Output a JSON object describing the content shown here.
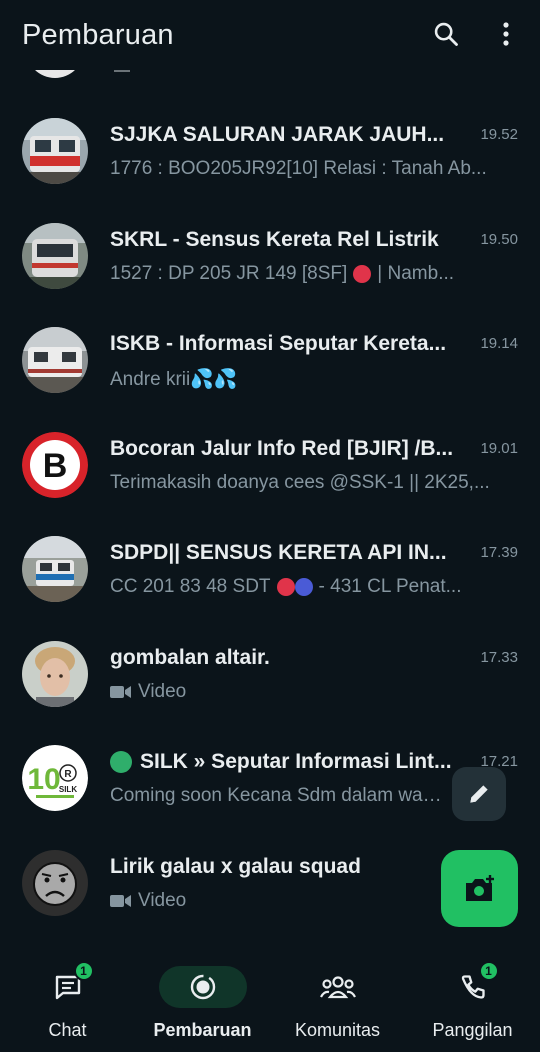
{
  "header": {
    "title": "Pembaruan"
  },
  "colors": {
    "background": "#0b141a",
    "accent": "#21c063",
    "secondary_text": "#8696a0"
  },
  "chats": [
    {
      "title": "SJJKA SALURAN JARAK JAUH...",
      "time": "19.52",
      "preview": "1776 : BOO205JR92[10] Relasi : Tanah Ab...",
      "avatar_icon": "train-photo-icon"
    },
    {
      "title": "SKRL - Sensus Kereta Rel Listrik",
      "time": "19.50",
      "preview": "1527 : DP 205 JR 149 [8SF]",
      "preview_suffix": "| Namb...",
      "avatar_icon": "train-photo-icon"
    },
    {
      "title": "ISKB - Informasi Seputar Kereta...",
      "time": "19.14",
      "preview": "Andre krii💦💦",
      "avatar_icon": "train-photo-icon"
    },
    {
      "title": "Bocoran Jalur Info Red [BJIR] /B...",
      "time": "19.01",
      "preview": "Terimakasih doanya cees @SSK-1 || 2K25,...",
      "avatar_icon": "letter-b-logo-icon",
      "avatar_letter": "B"
    },
    {
      "title": "SDPD|| SENSUS KERETA API IN...",
      "time": "17.39",
      "preview": "CC 201 83 48 SDT",
      "preview_suffix": "- 431 CL Penat...",
      "avatar_icon": "train-photo-icon"
    },
    {
      "title": "gombalan altair.",
      "time": "17.33",
      "preview": "Video",
      "avatar_icon": "person-photo-icon"
    },
    {
      "title": "SILK » Seputar Informasi Lint...",
      "time": "17.21",
      "preview": "Coming soon Kecana Sdm dalam wak...",
      "avatar_icon": "silk-logo-icon",
      "avatar_number": "10",
      "avatar_letter": "R",
      "avatar_text": "SILK"
    },
    {
      "title": "Lirik galau x galau squad",
      "time": "",
      "preview": "Video",
      "avatar_icon": "sad-face-icon"
    }
  ],
  "nav": [
    {
      "label": "Chat",
      "badge": "1",
      "icon": "chat-icon"
    },
    {
      "label": "Pembaruan",
      "icon": "updates-icon",
      "active": true
    },
    {
      "label": "Komunitas",
      "icon": "community-icon"
    },
    {
      "label": "Panggilan",
      "badge": "1",
      "icon": "phone-icon"
    }
  ]
}
